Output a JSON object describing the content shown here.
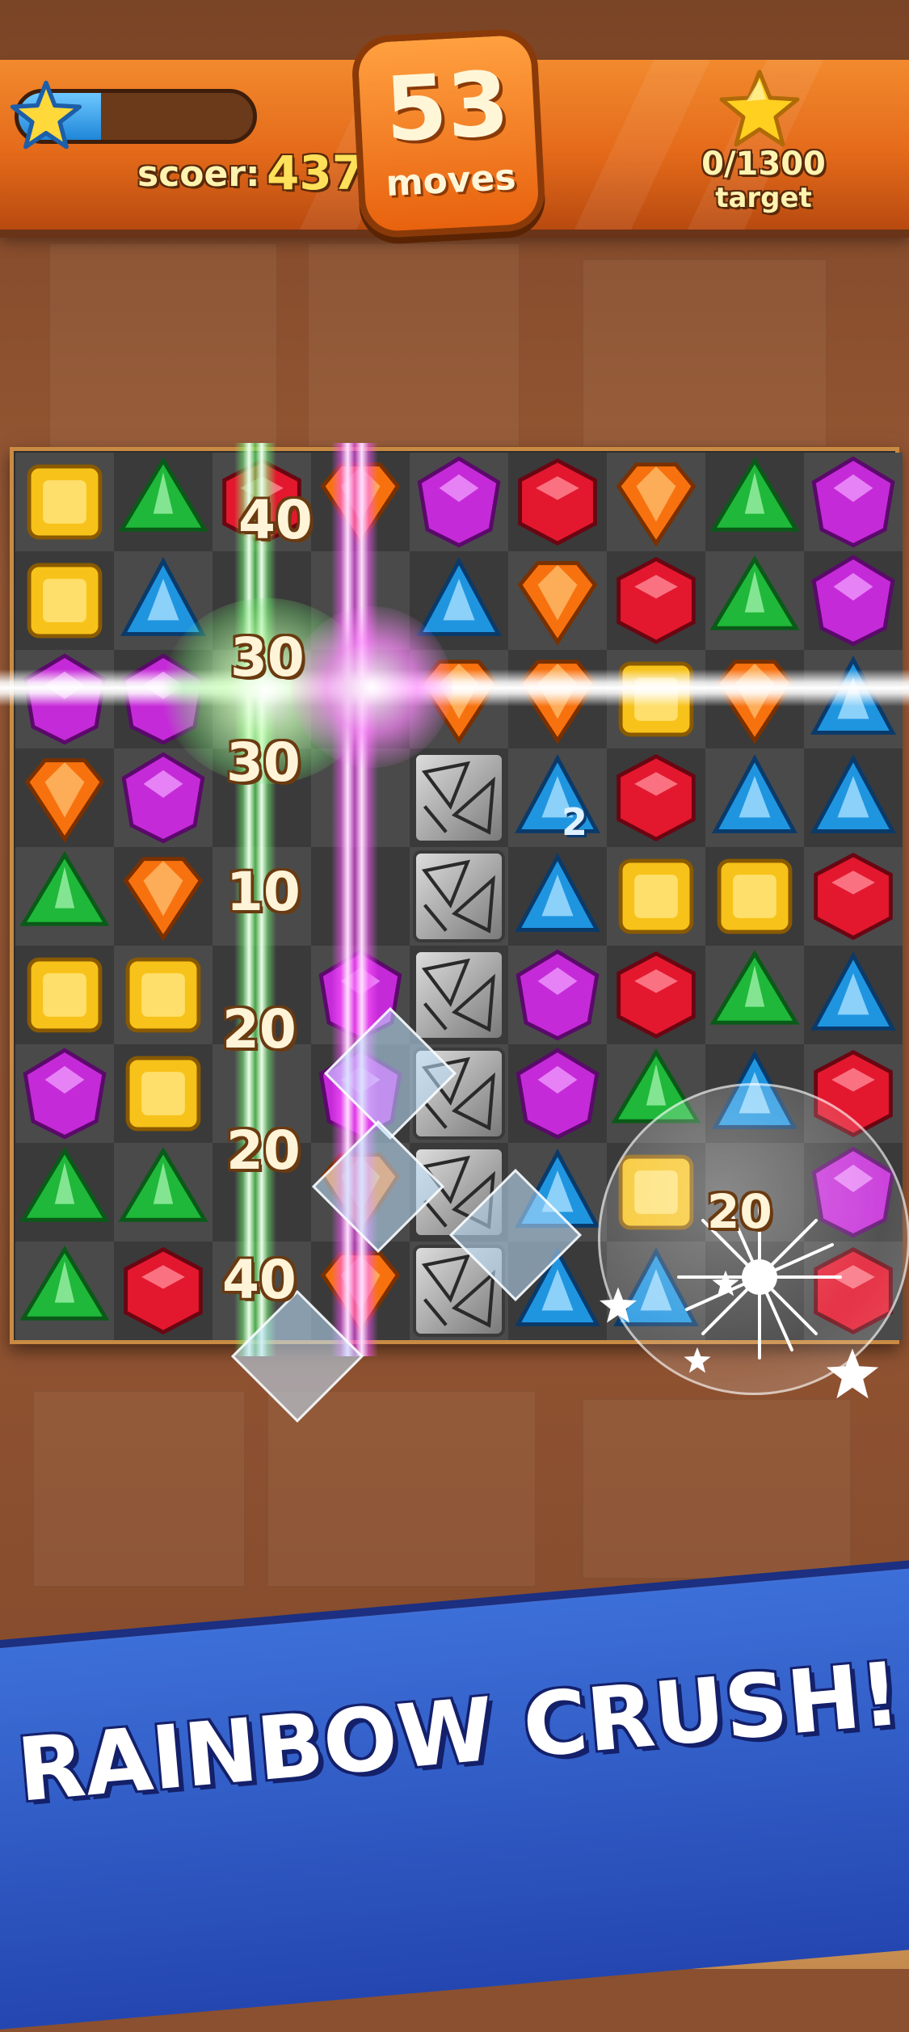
{
  "hud": {
    "score_label": "scoer:",
    "score_value": "437",
    "score_progress": 0.35,
    "moves_value": "53",
    "moves_label": "moves",
    "target_value": "0/1300",
    "target_label": "target"
  },
  "board": {
    "rows": [
      [
        "yellow-square",
        "green-pyramid",
        "red-hex",
        "orange-diamond",
        "purple-hex",
        "red-hex",
        "orange-diamond",
        "green-pyramid",
        "purple-hex"
      ],
      [
        "yellow-square",
        "blue-triangle",
        "",
        "",
        "blue-triangle",
        "orange-diamond",
        "red-hex",
        "green-pyramid",
        "purple-hex"
      ],
      [
        "purple-hex",
        "purple-hex",
        "",
        "",
        "orange-diamond",
        "orange-diamond",
        "yellow-square",
        "orange-diamond",
        "blue-triangle"
      ],
      [
        "orange-diamond",
        "purple-hex",
        "",
        "",
        "stone",
        "blue-triangle",
        "red-hex",
        "blue-triangle",
        "blue-triangle"
      ],
      [
        "green-pyramid",
        "orange-diamond",
        "",
        "",
        "stone",
        "blue-triangle",
        "yellow-square",
        "yellow-square",
        "red-hex"
      ],
      [
        "yellow-square",
        "yellow-square",
        "",
        "purple-hex",
        "stone",
        "purple-hex",
        "red-hex",
        "green-pyramid",
        "blue-triangle"
      ],
      [
        "purple-hex",
        "yellow-square",
        "",
        "purple-hex",
        "stone",
        "purple-hex",
        "green-pyramid",
        "blue-triangle",
        "red-hex"
      ],
      [
        "green-pyramid",
        "green-pyramid",
        "",
        "orange-diamond",
        "stone",
        "blue-triangle",
        "yellow-square",
        "",
        "purple-hex"
      ],
      [
        "green-pyramid",
        "red-hex",
        "",
        "orange-diamond",
        "stone",
        "blue-triangle",
        "blue-triangle",
        "",
        "red-hex"
      ]
    ],
    "tile_counter": "2",
    "score_pops": [
      "40",
      "30",
      "30",
      "10",
      "20",
      "20",
      "40",
      "20"
    ]
  },
  "banner": {
    "text": "RAINBOW CRUSH!"
  },
  "colors": {
    "yellow": "#f7c21a",
    "green": "#1fb83a",
    "red": "#e3182e",
    "orange": "#f7720f",
    "purple": "#c52ad8",
    "blue": "#1f95e0",
    "banner": "#2f5ccc"
  }
}
